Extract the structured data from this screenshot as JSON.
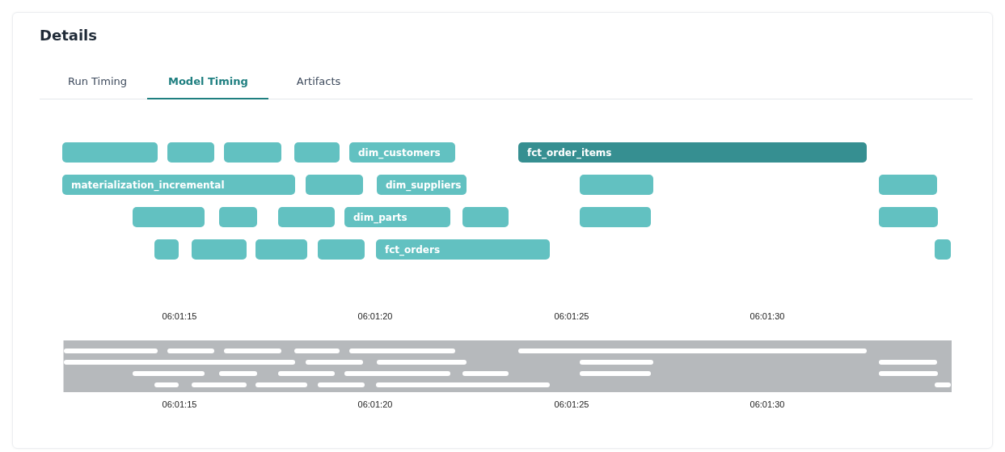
{
  "title": "Details",
  "tabs": [
    {
      "label": "Run Timing",
      "selected": false
    },
    {
      "label": "Model Timing",
      "selected": true
    },
    {
      "label": "Artifacts",
      "selected": false
    }
  ],
  "model_timing": {
    "lanes": [
      {
        "bars": [
          {
            "selected": false
          },
          {
            "selected": false
          },
          {
            "selected": false
          },
          {
            "selected": false
          },
          {
            "label": "dim_customers",
            "selected": false
          },
          {
            "label": "fct_order_items",
            "selected": true
          }
        ]
      },
      {
        "bars": [
          {
            "label": "materialization_incremental",
            "selected": false
          },
          {
            "selected": false
          },
          {
            "label": "dim_suppliers",
            "selected": false
          },
          {
            "selected": false
          },
          {
            "selected": false
          }
        ]
      },
      {
        "bars": [
          {
            "selected": false
          },
          {
            "selected": false
          },
          {
            "selected": false
          },
          {
            "label": "dim_parts",
            "selected": false
          },
          {
            "selected": false
          },
          {
            "selected": false
          },
          {
            "selected": false
          }
        ]
      },
      {
        "bars": [
          {
            "selected": false
          },
          {
            "selected": false
          },
          {
            "selected": false
          },
          {
            "selected": false
          },
          {
            "label": "fct_orders",
            "selected": false
          },
          {
            "selected": false
          }
        ]
      }
    ],
    "tick_labels": [
      "06:01:15",
      "06:01:20",
      "06:01:25",
      "06:01:30"
    ]
  },
  "overview": {
    "tick_labels": [
      "06:01:15",
      "06:01:20",
      "06:01:25",
      "06:01:30"
    ]
  }
}
